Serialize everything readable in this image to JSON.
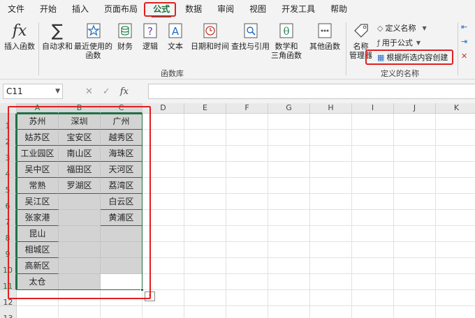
{
  "menu": {
    "items": [
      "文件",
      "开始",
      "插入",
      "页面布局",
      "公式",
      "数据",
      "审阅",
      "视图",
      "开发工具",
      "帮助"
    ],
    "active": "公式"
  },
  "ribbon": {
    "insert_function": "插入函数",
    "autosum": "自动求和",
    "recent_line1": "最近使用的",
    "recent_line2": "函数",
    "financial": "财务",
    "logical": "逻辑",
    "text": "文本",
    "datetime": "日期和时间",
    "lookup": "查找与引用",
    "math_line1": "数学和",
    "math_line2": "三角函数",
    "more": "其他函数",
    "group_function_library": "函数库",
    "name_manager_line1": "名称",
    "name_manager_line2": "管理器",
    "define_name": "定义名称",
    "use_in_formula": "用于公式",
    "create_from_selection": "根据所选内容创建",
    "group_defined_names": "定义的名称",
    "accent": "#1e7145",
    "highlight": "#e02020"
  },
  "formula_bar": {
    "name_box": "C11",
    "fx": "fx",
    "cancel": "✕",
    "confirm": "✓",
    "formula": ""
  },
  "sheet": {
    "columns": [
      "A",
      "B",
      "C",
      "D",
      "E",
      "F",
      "G",
      "H",
      "I",
      "J",
      "K"
    ],
    "rows": [
      "1",
      "2",
      "3",
      "4",
      "5",
      "6",
      "7",
      "8",
      "9",
      "10",
      "11",
      "12",
      "13"
    ],
    "col_a": [
      "苏州",
      "姑苏区",
      "工业园区",
      "吴中区",
      "常熟",
      "吴江区",
      "张家港",
      "昆山",
      "相城区",
      "高新区",
      "太仓"
    ],
    "col_b": [
      "深圳",
      "宝安区",
      "南山区",
      "福田区",
      "罗湖区",
      "",
      "",
      "",
      "",
      "",
      ""
    ],
    "col_c": [
      "广州",
      "越秀区",
      "海珠区",
      "天河区",
      "荔湾区",
      "白云区",
      "黄浦区",
      "",
      "",
      "",
      ""
    ]
  }
}
